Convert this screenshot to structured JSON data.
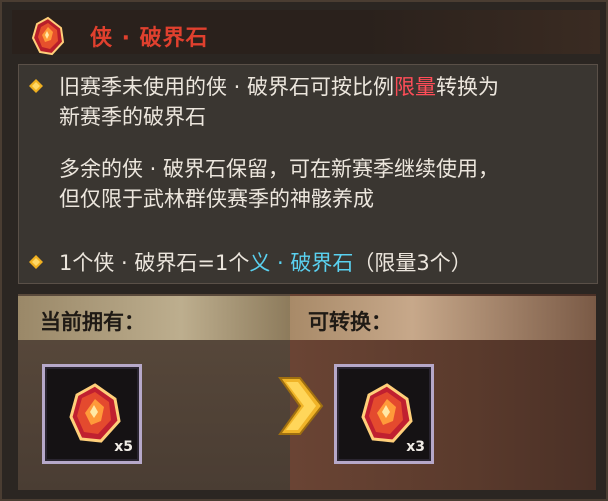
{
  "header": {
    "title": "侠 · 破界石"
  },
  "description": {
    "para1_line1_pre": "旧赛季未使用的侠 · 破界石可按比例",
    "para1_line1_hl": "限量",
    "para1_line1_post": "转换为",
    "para1_line2": "新赛季的破界石",
    "para2_line1": "多余的侠 · 破界石保留，可在新赛季继续使用，",
    "para2_line2": "但仅限于武林群侠赛季的神骸养成",
    "ratio_pre": "1个侠 · 破界石=1个",
    "ratio_hl": "义 · 破界石",
    "ratio_post": "（限量3个）"
  },
  "owned": {
    "label": "当前拥有：",
    "count": "x5"
  },
  "convertible": {
    "label": "可转换：",
    "count": "x3"
  },
  "colors": {
    "title_red": "#e0402e",
    "highlight_red": "#ff4d58",
    "highlight_cyan": "#5ad1f0",
    "bullet_gold": "#f0b020"
  },
  "icons": {
    "header": "gem-icon",
    "bullet": "diamond-bullet-icon",
    "arrow": "chevron-right-icon"
  }
}
